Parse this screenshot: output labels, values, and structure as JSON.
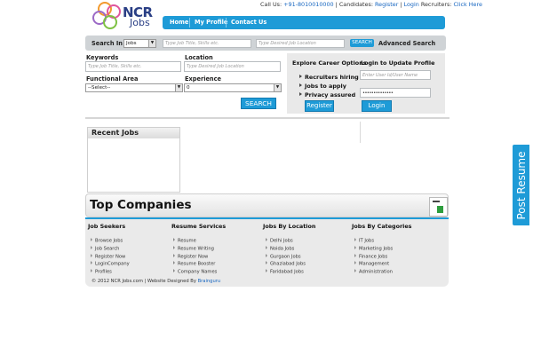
{
  "logo": {
    "word1": "NCR",
    "word2": "Jobs"
  },
  "topline": {
    "call_label": "Call Us: ",
    "phone": "+91-8010010000",
    "sep1": " | Candidates: ",
    "register": "Register",
    "sep2": " | ",
    "login": "Login",
    "recruiters": " Recruiters: ",
    "click_here": "Click Here"
  },
  "nav": {
    "items": [
      "Home",
      "My Profile",
      "Contact Us"
    ]
  },
  "search_strip": {
    "label": "Search In",
    "select_value": "Jobs",
    "job_placeholder": "Type Job Title, Skills etc.",
    "location_placeholder": "Type Desired Job Location",
    "button": "SEARCH",
    "advanced": "Advanced Search"
  },
  "form": {
    "keywords_label": "Keywords",
    "keywords_placeholder": "Type Job Title, Skills etc.",
    "location_label": "Location",
    "location_placeholder": "Type Desired Job Location",
    "functional_label": "Functional Area",
    "functional_value": "--Select--",
    "experience_label": "Experience",
    "experience_value": "0",
    "search_button": "SEARCH"
  },
  "explore": {
    "title": "Explore Career Options",
    "items": [
      "Recruiters hiring",
      "Jobs to apply",
      "Privacy assured"
    ],
    "register_button": "Register"
  },
  "login_panel": {
    "title": "Login to Update Profile",
    "user_placeholder": "Enter User Id/User Name",
    "password_value": "••••••••••••••",
    "login_button": "Login"
  },
  "recent_jobs": {
    "title": "Recent Jobs"
  },
  "companies": {
    "title": "Top Companies"
  },
  "footer": {
    "columns": [
      {
        "heading": "Job Seekers",
        "items": [
          "Browse Jobs",
          "Job Search",
          "Register Now",
          "LoginCompany",
          "Profiles"
        ]
      },
      {
        "heading": "Resume Services",
        "items": [
          "Resume",
          "Resume Writing",
          "Register Now",
          "Resume Booster",
          "Company Names"
        ]
      },
      {
        "heading": "Jobs By Location",
        "items": [
          "Delhi Jobs",
          "Noida Jobs",
          "Gurgaon Jobs",
          "Ghaziabad Jobs",
          "Faridabad Jobs"
        ]
      },
      {
        "heading": "Jobs By Categories",
        "items": [
          "IT Jobs",
          "Marketing Jobs",
          "Finance Jobs",
          "Management",
          "Administration"
        ]
      }
    ],
    "copyright": "© 2012 NCR Jobs.com | Website Designed By ",
    "designer": "Brainguru"
  },
  "post_resume": "Post Resume",
  "colors": {
    "brand_blue": "#1e9bd7",
    "link_blue": "#1565c0",
    "panel_gray": "#e9e9e9"
  }
}
